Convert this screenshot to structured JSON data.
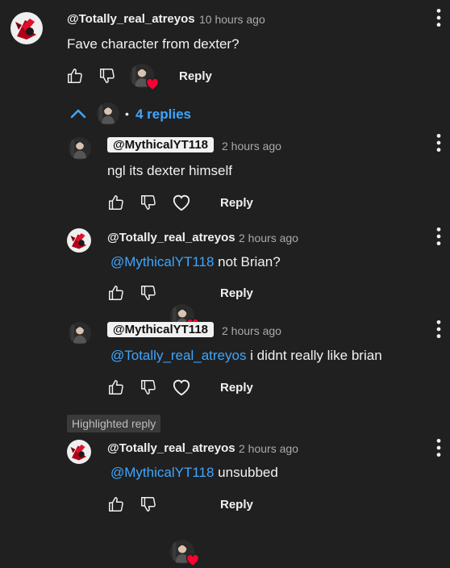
{
  "comment": {
    "author": "@Totally_real_atreyos",
    "time": "10 hours ago",
    "text": "Fave character from dexter?",
    "reply_label": "Reply"
  },
  "replies_toggle": {
    "count_label": "4 replies"
  },
  "replies": [
    {
      "author": "@MythicalYT118",
      "time": "2 hours ago",
      "mention": "",
      "text": "ngl its dexter himself",
      "reply_label": "Reply"
    },
    {
      "author": "@Totally_real_atreyos",
      "time": "2 hours ago",
      "mention": "@MythicalYT118",
      "text": " not Brian?",
      "reply_label": "Reply"
    },
    {
      "author": "@MythicalYT118",
      "time": "2 hours ago",
      "mention": "@Totally_real_atreyos",
      "text": " i didnt really like brian",
      "reply_label": "Reply"
    },
    {
      "author": "@Totally_real_atreyos",
      "time": "2 hours ago",
      "mention": "@MythicalYT118",
      "text": " unsubbed",
      "reply_label": "Reply"
    }
  ],
  "highlighted_label": "Highlighted reply",
  "colors": {
    "background": "#202020",
    "mention": "#3ea6ff",
    "heart": "#ff0033",
    "chip_bg": "#f1f1f1"
  }
}
